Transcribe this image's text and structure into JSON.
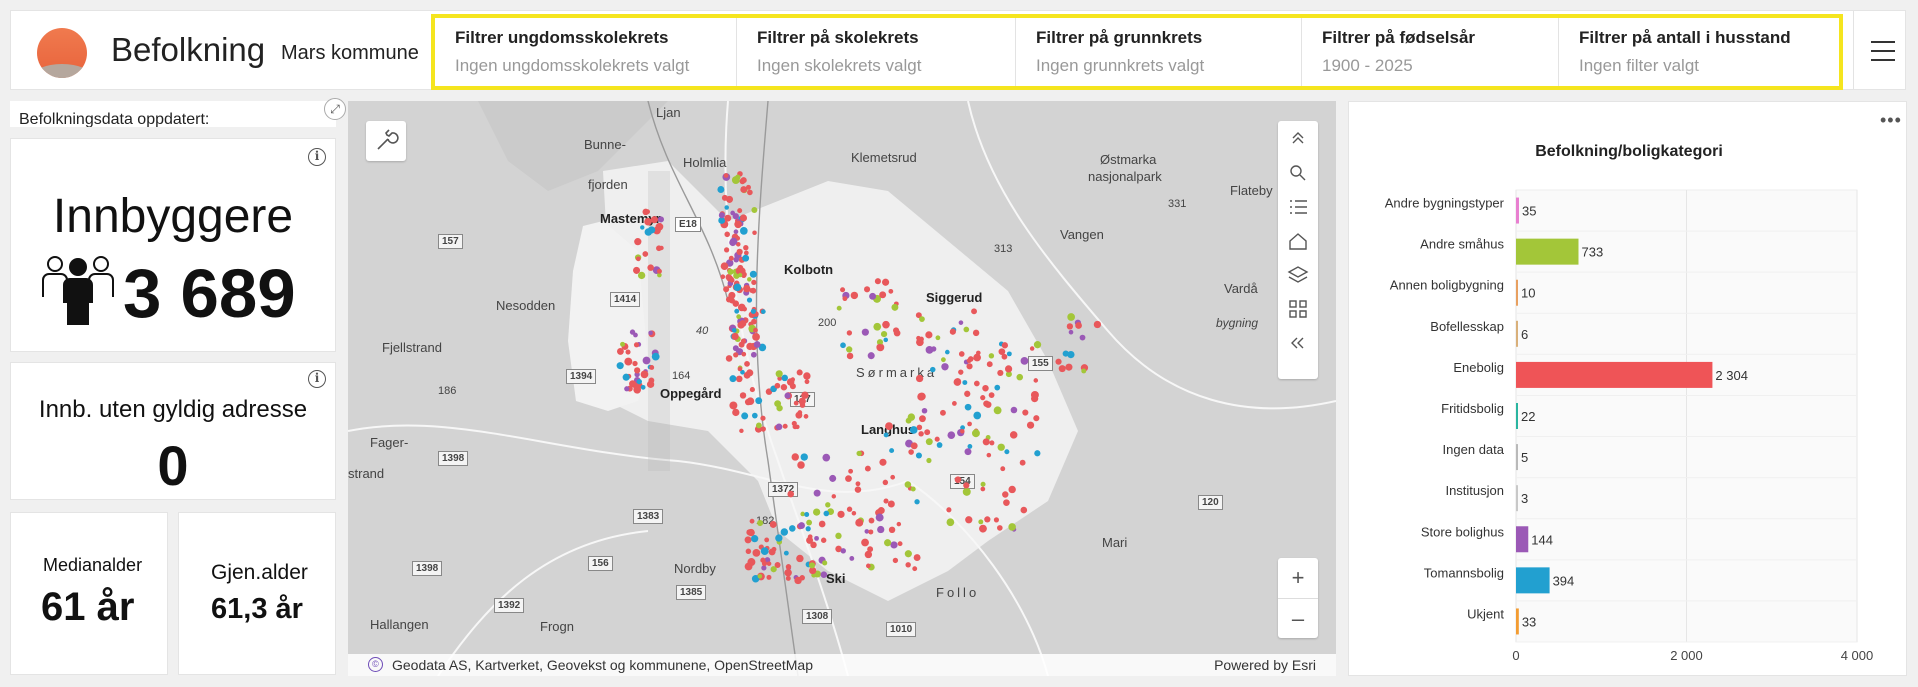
{
  "header": {
    "title": "Befolkning",
    "subtitle": "Mars kommune",
    "filters": [
      {
        "label": "Filtrer ungdomsskolekrets",
        "value": "Ingen ungdomsskolekrets valgt"
      },
      {
        "label": "Filtrer på skolekrets",
        "value": "Ingen skolekrets valgt"
      },
      {
        "label": "Filtrer på grunnkrets",
        "value": "Ingen grunnkrets valgt"
      },
      {
        "label": "Filtrer på fødselsår",
        "value": "1900 - 2025"
      },
      {
        "label": "Filtrer på antall i husstand",
        "value": "Ingen filter valgt"
      }
    ],
    "menu_icon": "hamburger-icon",
    "accent_color": "#f5e51e"
  },
  "updated": {
    "text": "Befolkningsdata oppdatert:"
  },
  "kpis": {
    "population": {
      "title": "Innbyggere",
      "value": "3 689"
    },
    "no_address": {
      "title": "Innb. uten gyldig adresse",
      "value": "0"
    },
    "median_age": {
      "title": "Medianalder",
      "value": "61 år"
    },
    "avg_age": {
      "title": "Gjen.alder",
      "value": "61,3 år"
    }
  },
  "map": {
    "places": [
      "Ljan",
      "Bunne-",
      "Holmlia",
      "fjorden",
      "Klemetsrud",
      "Østmarka",
      "nasjonalpark",
      "Flateby",
      "Mastemyr",
      "Kolbotn",
      "Vangen",
      "Nesodden",
      "Siggerud",
      "Vardå",
      "Fjellstrand",
      "Oppegård",
      "Sørmarka",
      "Fager-",
      "strand",
      "Langhus",
      "Mari",
      "Nordby",
      "Ski",
      "Follo",
      "Hallangen",
      "Frogn",
      "bygning"
    ],
    "roads": [
      "157",
      "1414",
      "1394",
      "137",
      "155",
      "1372",
      "154",
      "120",
      "1383",
      "1398",
      "156",
      "1385",
      "1392",
      "1398",
      "1010",
      "E18"
    ],
    "minor_roads": [
      "331",
      "313",
      "200",
      "186",
      "164",
      "40",
      "182",
      "1308"
    ],
    "attribution": "Geodata AS, Kartverket, Geovekst og kommunene, OpenStreetMap",
    "powered_by": "Powered by Esri",
    "zoom_in": "+",
    "zoom_out": "–"
  },
  "chart_data": {
    "type": "bar",
    "orientation": "horizontal",
    "title": "Befolkning/boligkategori",
    "categories": [
      "Andre bygningstyper",
      "Andre småhus",
      "Annen boligbygning",
      "Bofellesskap",
      "Enebolig",
      "Fritidsbolig",
      "Ingen data",
      "Institusjon",
      "Store bolighus",
      "Tomannsbolig",
      "Ukjent"
    ],
    "values": [
      35,
      733,
      10,
      6,
      2304,
      22,
      5,
      3,
      144,
      394,
      33
    ],
    "value_labels": [
      "35",
      "733",
      "10",
      "6",
      "2 304",
      "22",
      "5",
      "3",
      "144",
      "394",
      "33"
    ],
    "colors": [
      "#e87fd0",
      "#a3c639",
      "#e8a060",
      "#d9b07a",
      "#ef5457",
      "#2ab5a0",
      "#b9b9b9",
      "#c8c8c8",
      "#9b59b6",
      "#22a0d0",
      "#f39c32"
    ],
    "xlim": [
      0,
      4000
    ],
    "xticks": [
      "0",
      "2 000",
      "4 000"
    ],
    "grid": true
  }
}
